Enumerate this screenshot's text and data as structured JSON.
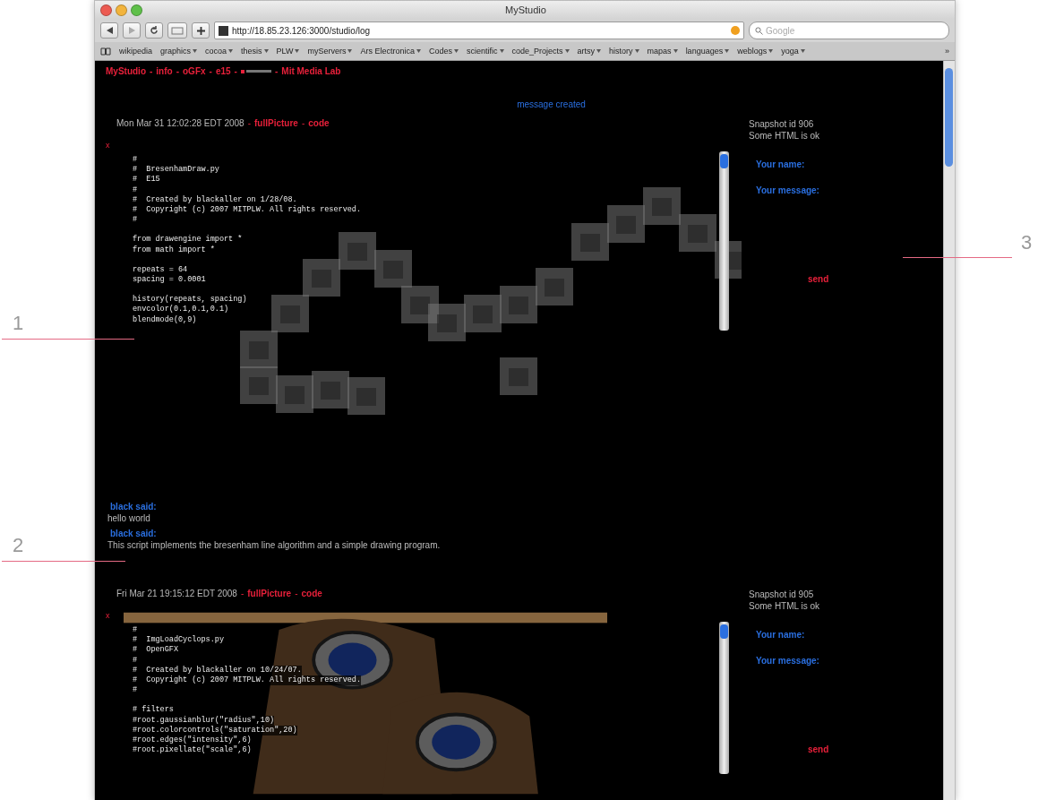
{
  "window": {
    "title": "MyStudio"
  },
  "toolbar": {
    "url": "http://18.85.23.126:3000/studio/log",
    "search_placeholder": "Google"
  },
  "bookmarks": [
    {
      "label": "wikipedia",
      "menu": false
    },
    {
      "label": "graphics",
      "menu": true
    },
    {
      "label": "cocoa",
      "menu": true
    },
    {
      "label": "thesis",
      "menu": true
    },
    {
      "label": "PLW",
      "menu": true
    },
    {
      "label": "myServers",
      "menu": true
    },
    {
      "label": "Ars Electronica",
      "menu": true
    },
    {
      "label": "Codes",
      "menu": true
    },
    {
      "label": "scientific",
      "menu": true
    },
    {
      "label": "code_Projects",
      "menu": true
    },
    {
      "label": "artsy",
      "menu": true
    },
    {
      "label": "history",
      "menu": true
    },
    {
      "label": "mapas",
      "menu": true
    },
    {
      "label": "languages",
      "menu": true
    },
    {
      "label": "weblogs",
      "menu": true
    },
    {
      "label": "yoga",
      "menu": true
    }
  ],
  "bookmarks_more": "»",
  "nav": {
    "links": [
      "MyStudio",
      "info",
      "oGFx",
      "e15"
    ],
    "last_link": "Mit Media Lab",
    "separator": "-"
  },
  "notice": "message created",
  "posts": [
    {
      "date": "Mon Mar 31 12:02:28 EDT 2008",
      "links": [
        "fullPicture",
        "code"
      ],
      "delete": "x",
      "kind": "cubes",
      "code": [
        [
          "#",
          "#  BresenhamDraw.py",
          "#  E15",
          "#",
          "#  Created by blackaller on 1/28/08.",
          "#  Copyright (c) 2007 MITPLW. All rights reserved.",
          "#"
        ],
        [
          "from drawengine import *",
          "from math import *"
        ],
        [
          "repeats = 64",
          "spacing = 0.0001"
        ],
        [
          "history(repeats, spacing)",
          "envcolor(0.1,0.1,0.1)",
          "blendmode(0,9)"
        ]
      ],
      "snapshot": "Snapshot id 906",
      "html_note": "Some HTML is ok",
      "name_label": "Your name:",
      "message_label": "Your message:",
      "send": "send",
      "comments": [
        {
          "author": "black said:",
          "text": "hello world"
        },
        {
          "author": "black said:",
          "text": "This script implements the bresenham line algorithm and a simple drawing program."
        }
      ]
    },
    {
      "date": "Fri Mar 21 19:15:12 EDT 2008",
      "links": [
        "fullPicture",
        "code"
      ],
      "delete": "x",
      "kind": "cartoon",
      "code": [
        [
          "#",
          "#  ImgLoadCyclops.py",
          "#  OpenGFX",
          "#",
          "#  Created by blackaller on 10/24/07.",
          "#  Copyright (c) 2007 MITPLW. All rights reserved.",
          "#"
        ],
        [
          "# filters",
          "#root.gaussianblur(\"radius\",10)",
          "#root.colorcontrols(\"saturation\",20)",
          "#root.edges(\"intensity\",6)",
          "#root.pixellate(\"scale\",6)"
        ]
      ],
      "snapshot": "Snapshot id 905",
      "html_note": "Some HTML is ok",
      "name_label": "Your name:",
      "message_label": "Your message:",
      "send": "send"
    }
  ],
  "callouts": [
    {
      "label": "1"
    },
    {
      "label": "2"
    },
    {
      "label": "3"
    }
  ]
}
